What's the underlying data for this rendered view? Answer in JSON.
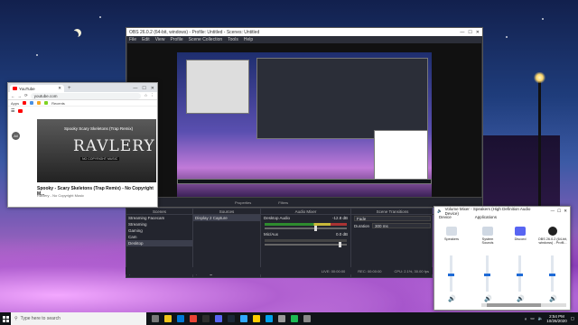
{
  "obs": {
    "title": "OBS 26.0.2 (64-bit, windows) - Profile: Untitled - Scenes: Untitled",
    "menu": [
      "File",
      "Edit",
      "View",
      "Profile",
      "Scene Collection",
      "Tools",
      "Help"
    ],
    "scenes_title": "Scenes",
    "scenes": [
      "Streaming Facecam",
      "Streaming",
      "Gaming",
      "Cam",
      "Desktop"
    ],
    "sources_title": "Sources",
    "sources": [
      "Display 2 Capture"
    ],
    "mixer_title": "Audio Mixer",
    "mixer_tracks": [
      {
        "name": "Desktop Audio",
        "db": "-12.8 dB"
      },
      {
        "name": "Mic/Aux",
        "db": "0.0 dB"
      }
    ],
    "transitions_title": "Scene Transitions",
    "transition_type": "Fade",
    "duration_label": "Duration",
    "duration_value": "300 ms",
    "properties_label": "Properties",
    "filters_label": "Filters",
    "status": {
      "live": "LIVE: 00:00:00",
      "rec": "REC: 00:00:00",
      "cpu": "CPU: 2.1%, 30.00 fps"
    }
  },
  "chrome": {
    "tab_title": "YouTube",
    "url": "youtube.com",
    "bookmarks": [
      "Apps",
      "Recents"
    ],
    "thumb_overlay": "Spooky Scary Skeletons (Trap Remix)",
    "thumb_logo": "RAVLERY",
    "thumb_sub": "NO COPYRIGHT MUSIC",
    "video_title": "Spooky - Scary Skeletons (Trap Remix) - No Copyright M...",
    "channel": "Ravlery - No Copyright Music",
    "chip_all": "All"
  },
  "volume_mixer": {
    "title": "Volume Mixer - Speakers (High Definition Audio Device)",
    "device_label": "Device",
    "applications_label": "Applications",
    "channels": [
      {
        "name": "Speakers",
        "level": 0.5
      },
      {
        "name": "System Sounds",
        "level": 0.5
      },
      {
        "name": "Discord",
        "level": 0.5
      },
      {
        "name": "OBS 26.0.2 (64-bit, windows) - Profil...",
        "level": 0.5
      }
    ]
  },
  "taskbar": {
    "search_placeholder": "Type here to search",
    "time": "2:54 PM",
    "date": "10/26/2020"
  },
  "colors": {
    "accent": "#1e6bd6",
    "obs_bg": "#2b2e38",
    "youtube_red": "#ff0000"
  }
}
